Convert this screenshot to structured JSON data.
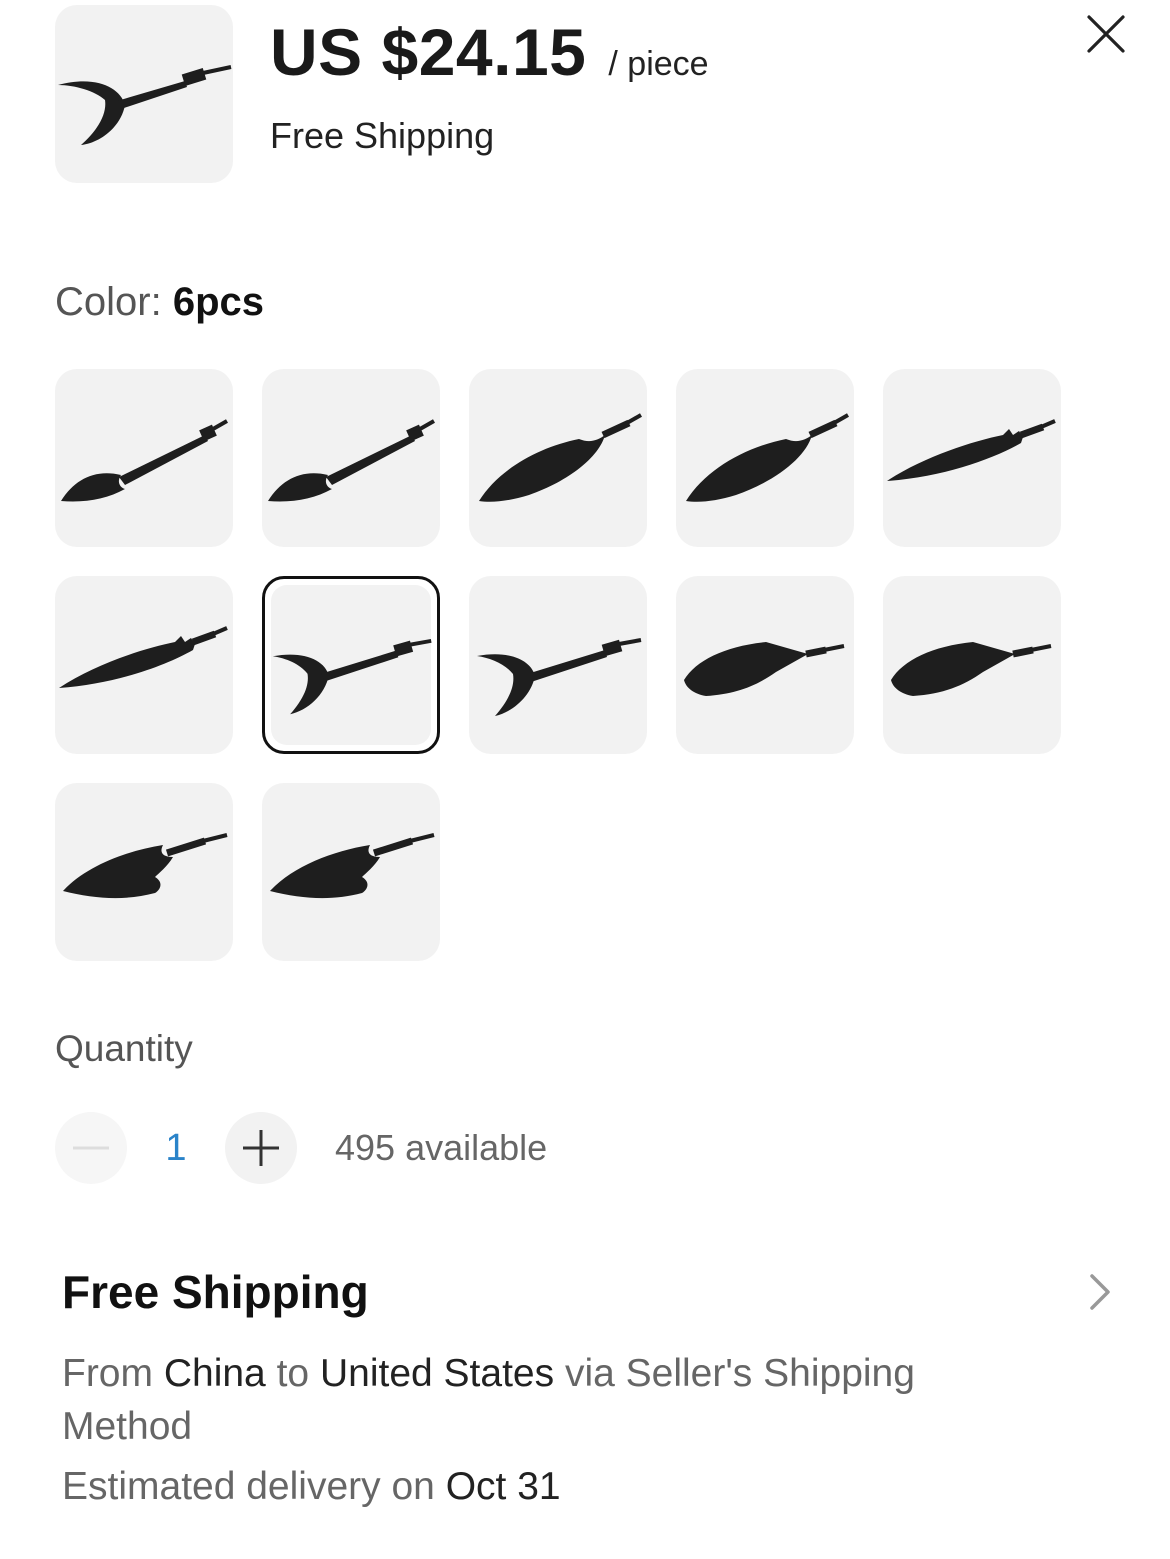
{
  "header": {
    "price": "US $24.15",
    "unit": "/ piece",
    "shipping": "Free Shipping",
    "close_icon": "close-icon",
    "thumbnail_icon": "crescent-arrowhead"
  },
  "color": {
    "label": "Color:",
    "selected_value": "6pcs",
    "options": [
      {
        "shape": "spade"
      },
      {
        "shape": "spade"
      },
      {
        "shape": "leaf"
      },
      {
        "shape": "leaf"
      },
      {
        "shape": "dart"
      },
      {
        "shape": "dart"
      },
      {
        "shape": "crescent",
        "selected": true
      },
      {
        "shape": "crescent"
      },
      {
        "shape": "wide"
      },
      {
        "shape": "wide"
      },
      {
        "shape": "barbed"
      },
      {
        "shape": "barbed"
      }
    ]
  },
  "quantity": {
    "label": "Quantity",
    "value": "1",
    "available": "495 available",
    "minus_icon": "minus-icon",
    "plus_icon": "plus-icon"
  },
  "shipping": {
    "title": "Free Shipping",
    "from_word": "From",
    "origin": "China",
    "to_word": "to",
    "destination": "United States",
    "method_text": "via Seller's Shipping Method",
    "eta_text": "Estimated delivery on",
    "eta_date": "Oct 31",
    "chevron_icon": "chevron-right-icon"
  },
  "colors": {
    "text_dark": "#111111",
    "text_muted": "#666666",
    "qty_value": "#2a83c9",
    "tile_bg": "#f2f2f2"
  }
}
